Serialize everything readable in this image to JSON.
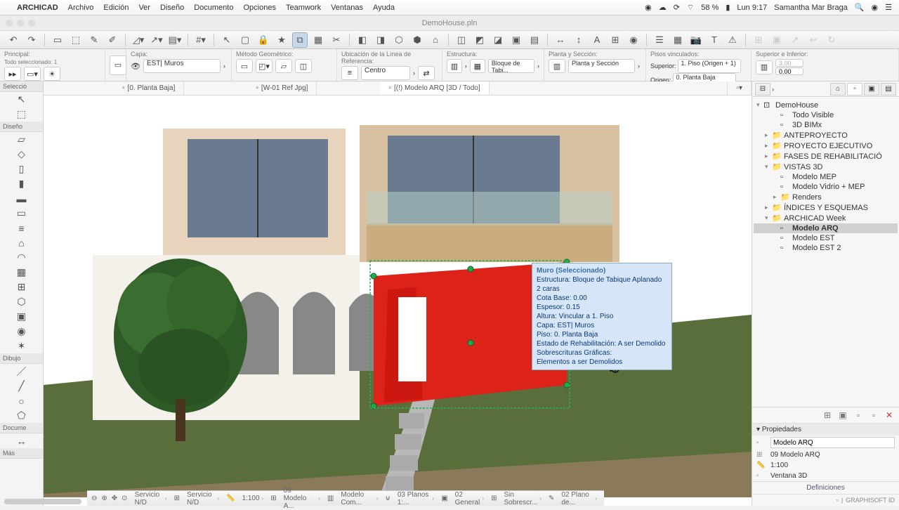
{
  "menubar": {
    "app": "ARCHICAD",
    "items": [
      "Archivo",
      "Edición",
      "Ver",
      "Diseño",
      "Documento",
      "Opciones",
      "Teamwork",
      "Ventanas",
      "Ayuda"
    ],
    "battery": "58 %",
    "clock": "Lun 9:17",
    "user": "Samantha Mar Braga"
  },
  "window": {
    "title": "DemoHouse.pln"
  },
  "infobar": {
    "principal_lbl": "Principal:",
    "todo_sel": "Todo seleccionado: 1",
    "capa_lbl": "Capa:",
    "capa_val": "EST| Muros",
    "metodo_lbl": "Método Geométrico:",
    "ubic_lbl": "Ubicación de la Línea de Referencia:",
    "ubic_val": "Centro",
    "estr_lbl": "Estructura:",
    "estr_val": "Bloque de Tabi...",
    "planta_lbl": "Planta y Sección:",
    "planta_val": "Planta y Sección",
    "pisos_lbl": "Pisos vinculados:",
    "sup_lbl": "Superior:",
    "sup_val": "1. Piso (Origen + 1)",
    "orig_lbl": "Origen:",
    "orig_val": "0. Planta Baja",
    "si_lbl": "Superior e Inferior:",
    "si_val1": "3.00",
    "si_val2": "0.00"
  },
  "tabs": [
    {
      "label": "[0. Planta Baja]",
      "active": false
    },
    {
      "label": "[W-01 Ref Jpg]",
      "active": false
    },
    {
      "label": "[(!) Modelo ARQ [3D / Todo]",
      "active": true
    }
  ],
  "left_sections": {
    "seleccio": "Selecció",
    "diseno": "Diseño",
    "dibujo": "Dibujo",
    "docume": "Docume",
    "mas": "Más"
  },
  "tooltip": {
    "title": "Muro (Seleccionado)",
    "l1": "Estructura: Bloque de Tabique Aplanado 2 caras",
    "l2": "Cota Base: 0.00",
    "l3": "Espesor: 0.15",
    "l4": "Altura: Vincular a 1. Piso",
    "l5": "Capa: EST| Muros",
    "l6": "Piso: 0. Planta Baja",
    "l7": "Estado de Rehabilitación: A ser Demolido",
    "l8": "Sobrescrituras Gráficas:",
    "l9": "Elementos a ser Demolidos"
  },
  "navigator": {
    "root": "DemoHouse",
    "items": [
      {
        "label": "Todo Visible",
        "depth": 2,
        "ico": "▫"
      },
      {
        "label": "3D BIMx",
        "depth": 2,
        "ico": "▫"
      },
      {
        "label": "ANTEPROYECTO",
        "depth": 1,
        "exp": "▸",
        "ico": "📁"
      },
      {
        "label": "PROYECTO EJECUTIVO",
        "depth": 1,
        "exp": "▸",
        "ico": "📁"
      },
      {
        "label": "FASES DE REHABILITACIÓ",
        "depth": 1,
        "exp": "▸",
        "ico": "📁"
      },
      {
        "label": "VISTAS 3D",
        "depth": 1,
        "exp": "▾",
        "ico": "📁"
      },
      {
        "label": "Modelo MEP",
        "depth": 2,
        "ico": "▫"
      },
      {
        "label": "Modelo Vidrio + MEP",
        "depth": 2,
        "ico": "▫"
      },
      {
        "label": "Renders",
        "depth": 2,
        "exp": "▸",
        "ico": "📁"
      },
      {
        "label": "ÍNDICES Y ESQUEMAS",
        "depth": 1,
        "exp": "▸",
        "ico": "📁"
      },
      {
        "label": "ARCHICAD Week",
        "depth": 1,
        "exp": "▾",
        "ico": "📁"
      },
      {
        "label": "Modelo ARQ",
        "depth": 2,
        "ico": "▫",
        "sel": true
      },
      {
        "label": "Modelo EST",
        "depth": 2,
        "ico": "▫"
      },
      {
        "label": "Modelo EST 2",
        "depth": 2,
        "ico": "▫"
      }
    ]
  },
  "properties": {
    "header": "Propiedades",
    "name": "Modelo ARQ",
    "row2": "09 Modelo ARQ",
    "scale": "1:100",
    "row4": "Ventana 3D",
    "def": "Definiciones"
  },
  "status": {
    "serv1": "Servicio N/D",
    "serv2": "Servicio N/D",
    "scale": "1:100",
    "s1": "09 Modelo A...",
    "s2": "Modelo Com...",
    "s3": "03 Planos 1:...",
    "s4": "02 General",
    "s5": "Sin Sobrescr...",
    "s6": "02 Plano de..."
  },
  "footer": "GRAPHISOFT ID"
}
